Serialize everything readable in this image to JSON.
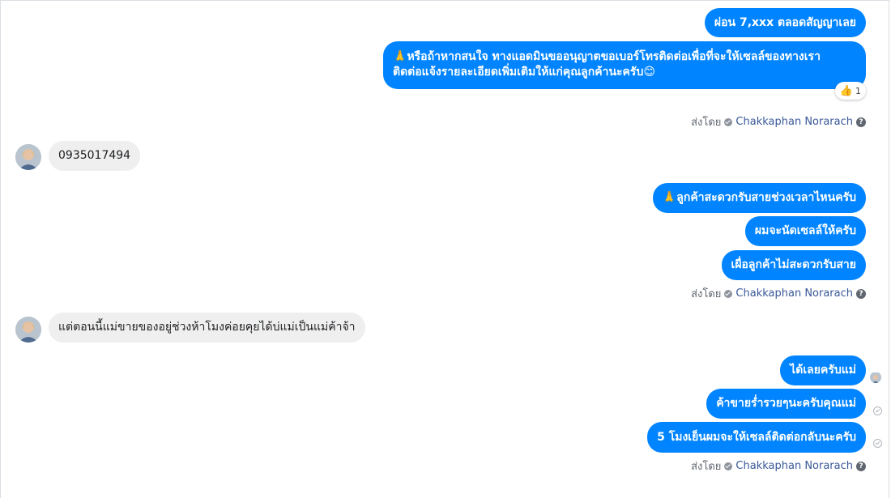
{
  "colors": {
    "outgoing_bubble": "#0084ff",
    "incoming_bubble": "#efefef",
    "sender_name": "#385898",
    "meta_text": "#606770"
  },
  "messages": {
    "m1": "ผ่อน 7,xxx ตลอดสัญญาเลย",
    "m2_line1": "หรือถ้าหากสนใจ ทางแอดมินขออนุญาตขอเบอร์โทรติดต่อเพื่อที่จะให้เซลล์ของทางเรา",
    "m2_line2": "ติดต่อแจ้งรายละเอียดเพิ่มเติมให้แก่คุณลูกค้านะครับ",
    "m2_emoji_start": "🙏",
    "m2_emoji_end": "😊",
    "m2_reaction_icon": "thumbs-up-icon",
    "m2_reaction_count": "1",
    "incoming1": "0935017494",
    "m3": "ลูกค้าสะดวกรับสายช่วงเวลาไหนครับ",
    "m3_emoji": "🙏",
    "m4": "ผมจะนัดเซลล์ให้ครับ",
    "m5": "เผื่อลูกค้าไม่สะดวกรับสาย",
    "incoming2": "แต่ตอนนี้แม่ขายของอยู่ช่วงห้าโมงค่อยคุยได้บ่แม่เป็นแม่ค้าจ้า",
    "m6": "ได้เลยครับแม่",
    "m7": "ค้าขายร่ำรวยๆนะครับคุณแม่",
    "m8": "5 โมงเย็นผมจะให้เซลล์ติดต่อกลับนะครับ"
  },
  "sent_by": {
    "label": "ส่งโดย",
    "name": "Chakkaphan Norarach",
    "help": "?"
  }
}
